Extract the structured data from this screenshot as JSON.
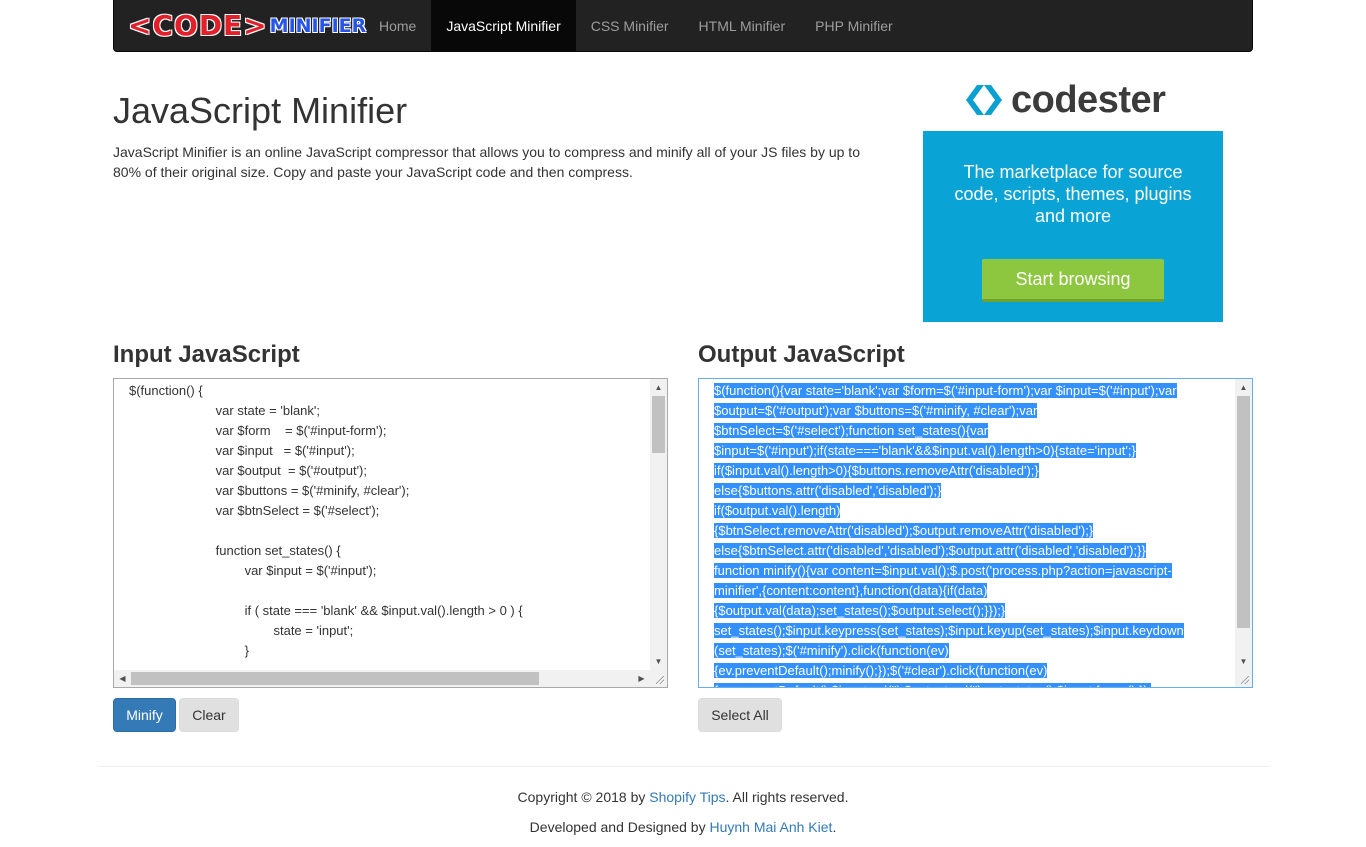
{
  "navbar": {
    "brand_code": "<CODE>",
    "brand_minifier": "MINIFIER",
    "items": [
      "Home",
      "JavaScript Minifier",
      "CSS Minifier",
      "HTML Minifier",
      "PHP Minifier"
    ],
    "active": "JavaScript Minifier"
  },
  "header": {
    "title": "JavaScript Minifier",
    "description": "JavaScript Minifier is an online JavaScript compressor that allows you to compress and minify all of your JS files by up to 80% of their original size. Copy and paste your JavaScript code and then compress."
  },
  "ad": {
    "logo_text": "codester",
    "tagline": "The marketplace for source code, scripts, themes, plugins and more",
    "button": "Start browsing",
    "colors": {
      "background": "#09a3d5",
      "button": "#8dc63f"
    }
  },
  "input": {
    "title": "Input JavaScript",
    "lines": [
      "$(function() {",
      "                        var state = 'blank';",
      "                        var $form    = $('#input-form');",
      "                        var $input   = $('#input');",
      "                        var $output  = $('#output');",
      "                        var $buttons = $('#minify, #clear');",
      "                        var $btnSelect = $('#select');",
      "",
      "                        function set_states() {",
      "                                var $input = $('#input');",
      "",
      "                                if ( state === 'blank' && $input.val().length > 0 ) {",
      "                                        state = 'input';",
      "                                }"
    ]
  },
  "output": {
    "title": "Output JavaScript",
    "lines": [
      "$(function(){var state='blank';var $form=$('#input-form');var $input=$('#input');var",
      "$output=$('#output');var $buttons=$('#minify, #clear');var",
      "$btnSelect=$('#select');function set_states(){var",
      "$input=$('#input');if(state==='blank'&&$input.val().length>0){state='input';}",
      "if($input.val().length>0){$buttons.removeAttr('disabled');}",
      "else{$buttons.attr('disabled','disabled');}",
      "if($output.val().length)",
      "{$btnSelect.removeAttr('disabled');$output.removeAttr('disabled');}",
      "else{$btnSelect.attr('disabled','disabled');$output.attr('disabled','disabled');}}",
      "function minify(){var content=$input.val();$.post('process.php?action=javascript-",
      "minifier',{content:content},function(data){if(data)",
      "{$output.val(data);set_states();$output.select();}});}",
      "set_states();$input.keypress(set_states);$input.keyup(set_states);$input.keydown",
      "(set_states);$('#minify').click(function(ev)",
      "{ev.preventDefault();minify();});$('#clear').click(function(ev)",
      "{ev.preventDefault();$input.val('');$output.val('');set_states();$input.focus();});"
    ]
  },
  "buttons": {
    "minify": "Minify",
    "clear": "Clear",
    "select_all": "Select All"
  },
  "footer": {
    "copyright_prefix": "Copyright © 2018 by ",
    "copyright_link": "Shopify Tips",
    "copyright_suffix": ". All rights reserved.",
    "developed_prefix": "Developed and Designed by ",
    "developed_link": "Huynh Mai Anh Kiet",
    "developed_suffix": "."
  }
}
